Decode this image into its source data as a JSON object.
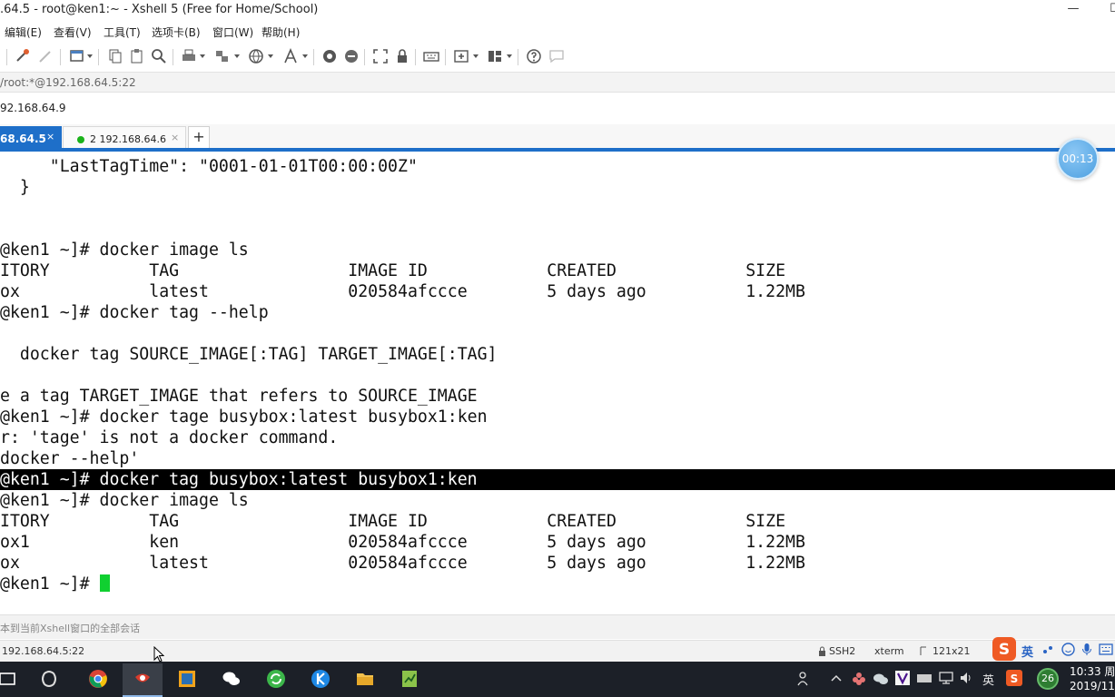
{
  "window": {
    "title": ".64.5 - root@ken1:~ - Xshell 5 (Free for Home/School)",
    "minimize_glyph": "—",
    "maximize_glyph": "☐"
  },
  "menu": {
    "items": [
      "编辑(E)",
      "查看(V)",
      "工具(T)",
      "选项卡(B)",
      "窗口(W)",
      "帮助(H)"
    ]
  },
  "address": {
    "text": "/root:*@192.168.64.5:22"
  },
  "session": {
    "text": "92.168.64.9"
  },
  "tabs": {
    "active_label": "68.64.5",
    "second_label": "2 192.168.64.6",
    "close_glyph": "×",
    "add_glyph": "+"
  },
  "timer": {
    "text": "00:13"
  },
  "terminal": {
    "lines": [
      "     \"LastTagTime\": \"0001-01-01T00:00:00Z\"",
      "  }",
      "",
      "",
      "@ken1 ~]# docker image ls",
      "ITORY          TAG                 IMAGE ID            CREATED             SIZE",
      "ox             latest              020584afccce        5 days ago          1.22MB",
      "@ken1 ~]# docker tag --help",
      "",
      "  docker tag SOURCE_IMAGE[:TAG] TARGET_IMAGE[:TAG]",
      "",
      "e a tag TARGET_IMAGE that refers to SOURCE_IMAGE",
      "@ken1 ~]# docker tage busybox:latest busybox1:ken",
      "r: 'tage' is not a docker command.",
      "docker --help'",
      "@ken1 ~]# docker tag busybox:latest busybox1:ken",
      "@ken1 ~]# docker image ls",
      "ITORY          TAG                 IMAGE ID            CREATED             SIZE",
      "ox1            ken                 020584afccce        5 days ago          1.22MB",
      "ox             latest              020584afccce        5 days ago          1.22MB",
      "@ken1 ~]# "
    ]
  },
  "compose": {
    "text": "本到当前Xshell窗口的全部会话"
  },
  "status": {
    "connection": "192.168.64.5:22",
    "protocol": "SSH2",
    "terminal_type": "xterm",
    "size": "121x21"
  },
  "taskbar": {
    "apps": [
      "task-view",
      "app-360",
      "chrome",
      "xshell",
      "vmware",
      "wechat",
      "refresh-app",
      "k-app",
      "file-explorer",
      "notepad-app"
    ],
    "tray": {
      "ime_label": "英",
      "ime_lang": "英",
      "badge": "26",
      "time": "10:33 周",
      "date": "2019/11/"
    }
  },
  "colors": {
    "accent": "#1e6fc9",
    "terminal_bg": "#ffffff",
    "terminal_fg": "#111111",
    "highlight_bg": "#000000",
    "cursor": "#10d030",
    "taskbar_bg": "#1c2028"
  }
}
